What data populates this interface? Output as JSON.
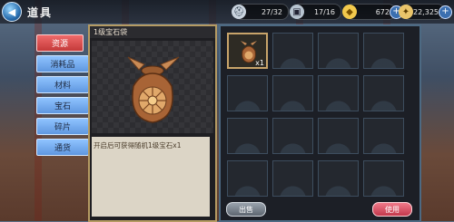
{
  "window": {
    "title": "道具",
    "back_icon": "back-arrow-icon"
  },
  "resources": [
    {
      "icon": "helmet-icon",
      "value": "27/32"
    },
    {
      "icon": "card-icon",
      "value": "17/16"
    },
    {
      "icon": "coin-icon",
      "value": "672"
    },
    {
      "icon": "gem-icon",
      "value": "22,325"
    }
  ],
  "tabs": [
    {
      "label": "资源",
      "active": true
    },
    {
      "label": "消耗品",
      "active": false
    },
    {
      "label": "材料",
      "active": false
    },
    {
      "label": "宝石",
      "active": false
    },
    {
      "label": "碎片",
      "active": false
    },
    {
      "label": "通货",
      "active": false
    }
  ],
  "detail": {
    "name": "1级宝石袋",
    "description": "开启后可获得随机1级宝石x1",
    "item_icon": "gem-pouch-icon"
  },
  "inventory": {
    "slots": [
      {
        "item": "gem-pouch-icon",
        "count": "x1"
      },
      {
        "item": null
      },
      {
        "item": null
      },
      {
        "item": null
      },
      {
        "item": null
      },
      {
        "item": null
      },
      {
        "item": null
      },
      {
        "item": null
      },
      {
        "item": null
      },
      {
        "item": null
      },
      {
        "item": null
      },
      {
        "item": null
      },
      {
        "item": null
      },
      {
        "item": null
      },
      {
        "item": null
      },
      {
        "item": null
      }
    ]
  },
  "actions": {
    "sell_label": "出售",
    "use_label": "使用"
  }
}
